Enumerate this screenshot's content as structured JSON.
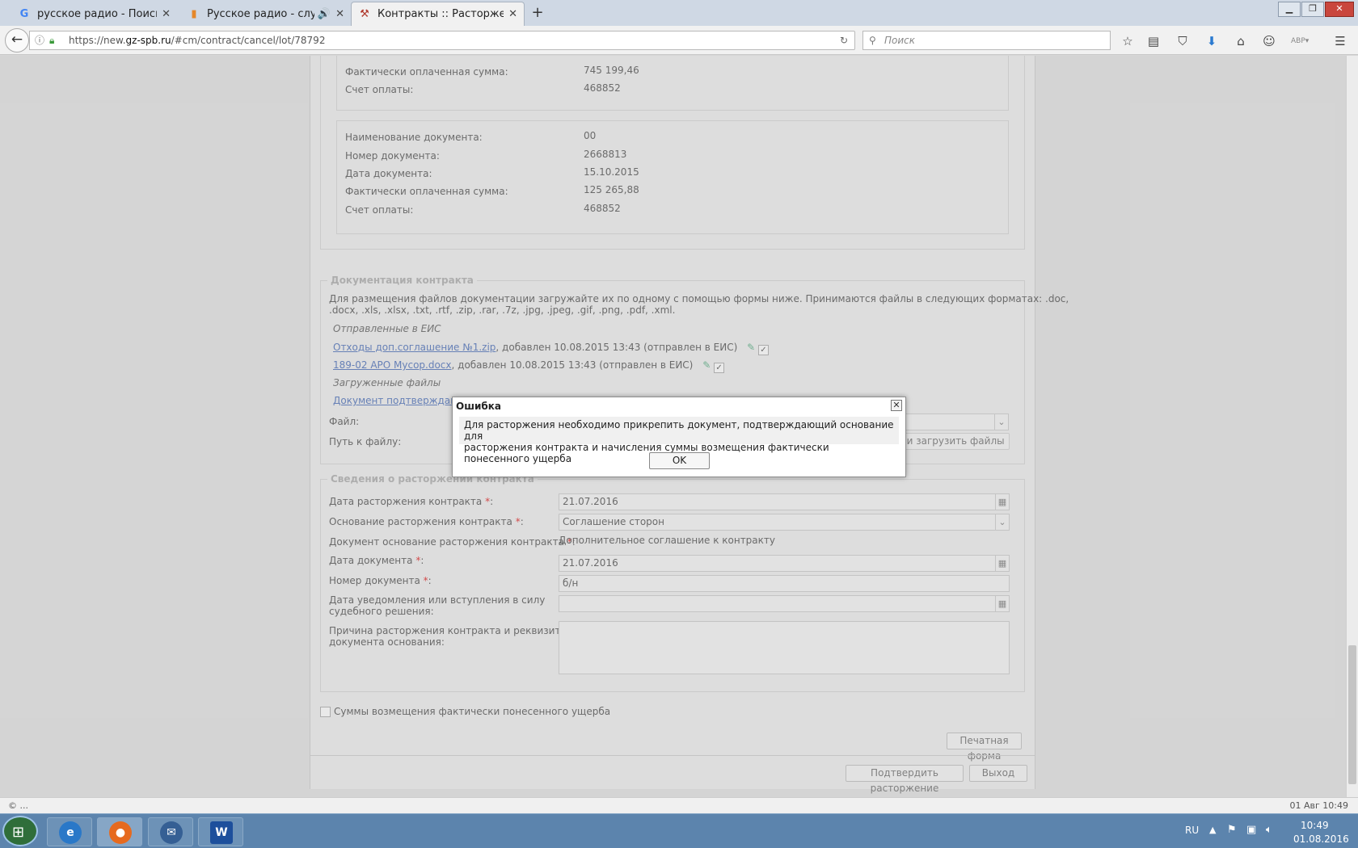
{
  "browser": {
    "tabs": [
      {
        "title": "русское радио - Поиск в ...",
        "favicon": "google-g"
      },
      {
        "title": "Русское радио - слуш...",
        "favicon": "chart-bars",
        "audio": "🔊"
      },
      {
        "title": "Контракты :: Расторжени...",
        "favicon": "tools"
      }
    ],
    "url_prefix": "https://new.",
    "url_domain": "gz-spb.ru",
    "url_path": "/#cm/contract/cancel/lot/78792",
    "search_placeholder": "Поиск",
    "toolbar_icons": [
      "star-icon",
      "reader-icon",
      "pocket-icon",
      "download-icon",
      "home-icon",
      "chat-icon",
      "abp-icon",
      "menu-icon"
    ]
  },
  "payments": {
    "block1": {
      "paid_label": "Фактически оплаченная сумма:",
      "paid_value": "745 199,46",
      "account_label": "Счет оплаты:",
      "account_value": "468852"
    },
    "block2": {
      "name_label": "Наименование документа:",
      "name_value": "00",
      "number_label": "Номер документа:",
      "number_value": "2668813",
      "date_label": "Дата документа:",
      "date_value": "15.10.2015",
      "paid_label": "Фактически оплаченная сумма:",
      "paid_value": "125 265,88",
      "account_label": "Счет оплаты:",
      "account_value": "468852"
    }
  },
  "documentation": {
    "legend": "Документация контракта",
    "info_line1": "Для размещения файлов документации загружайте их по одному с помощью формы ниже. Принимаются файлы в следующих форматах: .doc,",
    "info_line2": ".docx, .xls, .xlsx, .txt, .rtf, .zip, .rar, .7z, .jpg, .jpeg, .gif, .png, .pdf, .xml.",
    "sent_heading": "Отправленные в ЕИС",
    "sent_files": [
      {
        "name": "Отходы доп.соглашение №1.zip",
        "meta": ", добавлен 10.08.2015 13:43 (отправлен в ЕИС)"
      },
      {
        "name": "189-02 АРО Мусор.docx",
        "meta": ", добавлен 10.08.2015 13:43 (отправлен в ЕИС)"
      }
    ],
    "uploaded_heading": "Загруженные файлы",
    "uploaded_file": "Документ подтверждающ",
    "file_label": "Файл:",
    "path_label": "Путь к файлу:",
    "upload_button": "брать и загрузить файлы"
  },
  "termination": {
    "legend": "Сведения о расторжении контракта",
    "date_label": "Дата расторжения контракта ",
    "date_value": "21.07.2016",
    "basis_label": "Основание расторжения контракта ",
    "basis_value": "Соглашение сторон",
    "doc_basis_label": "Документ основание расторжения контракта ",
    "doc_basis_value": "Дополнительное соглашение к контракту",
    "doc_date_label": "Дата документа ",
    "doc_date_value": "21.07.2016",
    "doc_number_label": "Номер документа ",
    "doc_number_value": "б/н",
    "notice_label_1": "Дата уведомления или вступления в силу",
    "notice_label_2": "судебного решения:",
    "reason_label_1": "Причина расторжения контракта и реквизиты",
    "reason_label_2": "документа основания:",
    "required_mark": "*",
    "colon": ":"
  },
  "damages_checkbox_label": "Суммы возмещения фактически понесенного ущерба",
  "buttons": {
    "print": "Печатная форма",
    "confirm": "Подтвердить расторжение",
    "exit": "Выход"
  },
  "dialog": {
    "title": "Ошибка",
    "message_line1": "Для расторжения необходимо прикрепить документ, подтверждающий основание для",
    "message_line2": "расторжения контракта и начисления суммы возмещения фактически понесенного ущерба",
    "ok_label": "OK"
  },
  "statusbar": {
    "left": "© ...",
    "right": "01 Авг 10:49"
  },
  "taskbar": {
    "lang": "RU",
    "time": "10:49",
    "date": "01.08.2016"
  }
}
